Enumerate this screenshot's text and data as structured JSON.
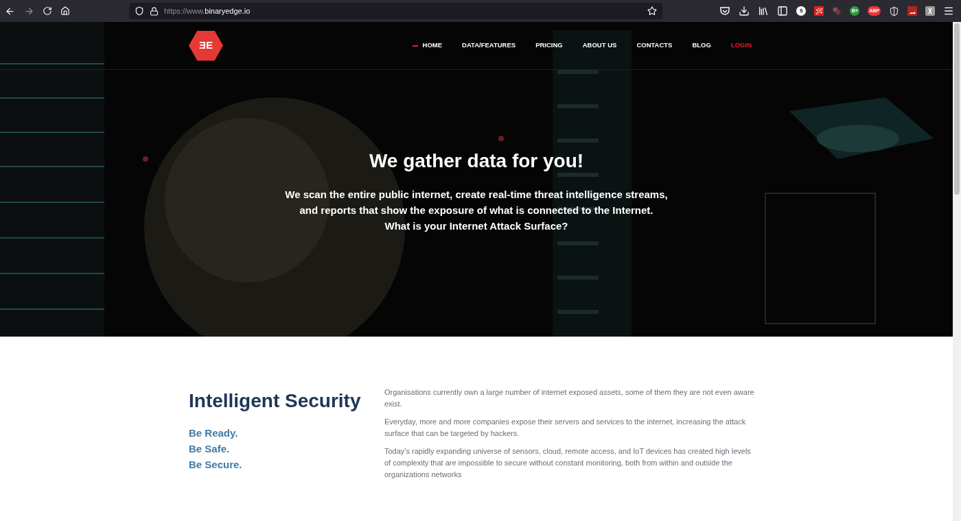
{
  "browser": {
    "url_host": "https://www.",
    "url_domain": "binaryedge.io",
    "extensions": [
      {
        "kind": "pocket"
      },
      {
        "kind": "download"
      },
      {
        "kind": "library"
      },
      {
        "kind": "sidebar"
      },
      {
        "kind": "badge",
        "label": "S",
        "color": "#ffffff"
      },
      {
        "kind": "wand"
      },
      {
        "kind": "dots"
      },
      {
        "kind": "badge",
        "label": "B+",
        "color": "#2e9e3e"
      },
      {
        "kind": "badge",
        "label": "ABP",
        "color": "#e8353b"
      },
      {
        "kind": "shield"
      },
      {
        "kind": "chart"
      },
      {
        "kind": "tile"
      },
      {
        "kind": "menu"
      }
    ]
  },
  "site": {
    "logo": "ƎE",
    "nav": [
      {
        "label": "HOME",
        "selected": true,
        "kind": "link"
      },
      {
        "label": "DATA/FEATURES",
        "selected": false,
        "kind": "link"
      },
      {
        "label": "PRICING",
        "selected": false,
        "kind": "link"
      },
      {
        "label": "ABOUT US",
        "selected": false,
        "kind": "link"
      },
      {
        "label": "CONTACTS",
        "selected": false,
        "kind": "link"
      },
      {
        "label": "BLOG",
        "selected": false,
        "kind": "link"
      },
      {
        "label": "LOGIN",
        "selected": false,
        "kind": "login"
      }
    ],
    "hero": {
      "title": "We gather data for you!",
      "lines": [
        "We scan the entire public internet, create real-time threat intelligence streams,",
        "and reports that show the exposure of what is connected to the Internet.",
        "What is your Internet Attack Surface?"
      ]
    },
    "intro": {
      "heading": "Intelligent Security",
      "slogans": [
        "Be Ready.",
        "Be Safe.",
        "Be Secure."
      ],
      "paragraphs": [
        "Organisations currently own a large number of internet exposed assets, some of them they are not even aware exist.",
        "Everyday, more and more companies expose their servers and services to the internet, increasing the attack surface that can be targeted by hackers.",
        "Today's rapidly expanding universe of sensors, cloud, remote access, and IoT devices has created high levels of complexity that are impossible to secure without constant monitoring, both from within and outside the organizations networks"
      ]
    }
  }
}
